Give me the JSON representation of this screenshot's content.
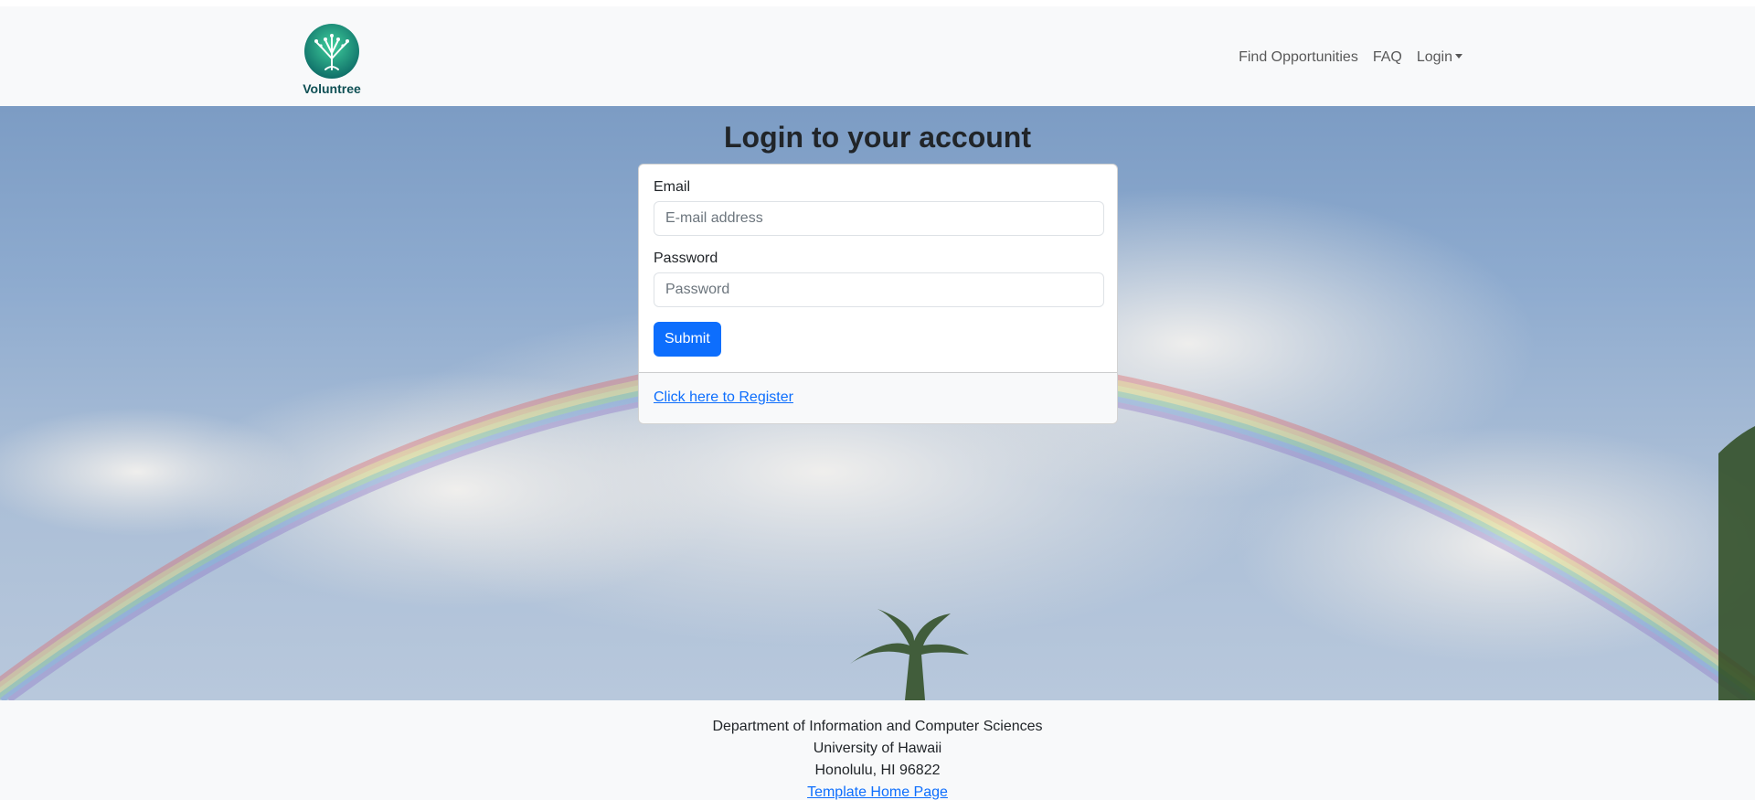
{
  "navbar": {
    "logo_text": "Voluntree",
    "links": [
      "Find Opportunities",
      "FAQ",
      "Login"
    ]
  },
  "main": {
    "title": "Login to your account",
    "email_label": "Email",
    "email_placeholder": "E-mail address",
    "password_label": "Password",
    "password_placeholder": "Password",
    "submit_label": "Submit",
    "register_link": "Click here to Register"
  },
  "footer": {
    "line1": "Department of Information and Computer Sciences",
    "line2": "University of Hawaii",
    "line3": "Honolulu, HI 96822",
    "link": "Template Home Page"
  },
  "colors": {
    "primary": "#0d6efd",
    "navbar_bg": "#f8f9fa",
    "logo_green": "#1a9d7a"
  }
}
